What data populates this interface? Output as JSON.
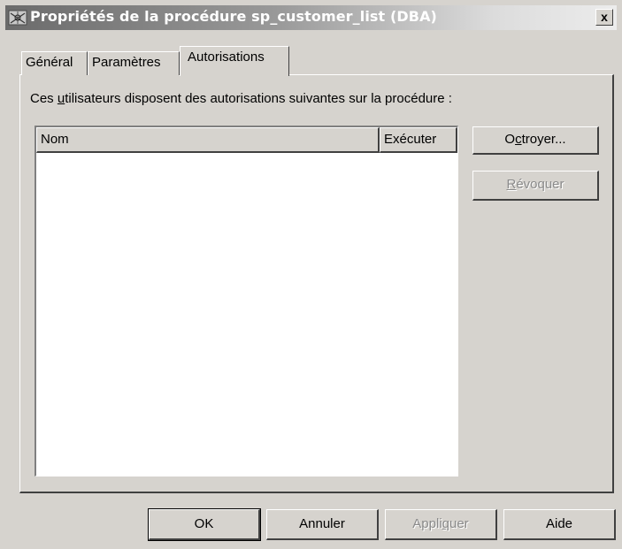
{
  "window": {
    "title": "Propriétés de la procédure sp_customer_list (DBA)",
    "close_label": "x"
  },
  "tabs": [
    {
      "label": "Général",
      "active": false
    },
    {
      "label": "Paramètres",
      "active": false
    },
    {
      "label": "Autorisations",
      "active": true
    }
  ],
  "panel": {
    "description_prefix": "Ces ",
    "description_accel": "u",
    "description_suffix": "tilisateurs disposent des autorisations suivantes sur la procédure :"
  },
  "list": {
    "columns": [
      "Nom",
      "Exécuter"
    ],
    "rows": []
  },
  "side_buttons": {
    "grant_prefix": "O",
    "grant_accel": "c",
    "grant_suffix": "troyer...",
    "revoke_accel": "R",
    "revoke_suffix": "évoquer"
  },
  "footer_buttons": {
    "ok": "OK",
    "cancel": "Annuler",
    "apply_prefix": "Appli",
    "apply_accel": "q",
    "apply_suffix": "uer",
    "help": "Aide"
  }
}
